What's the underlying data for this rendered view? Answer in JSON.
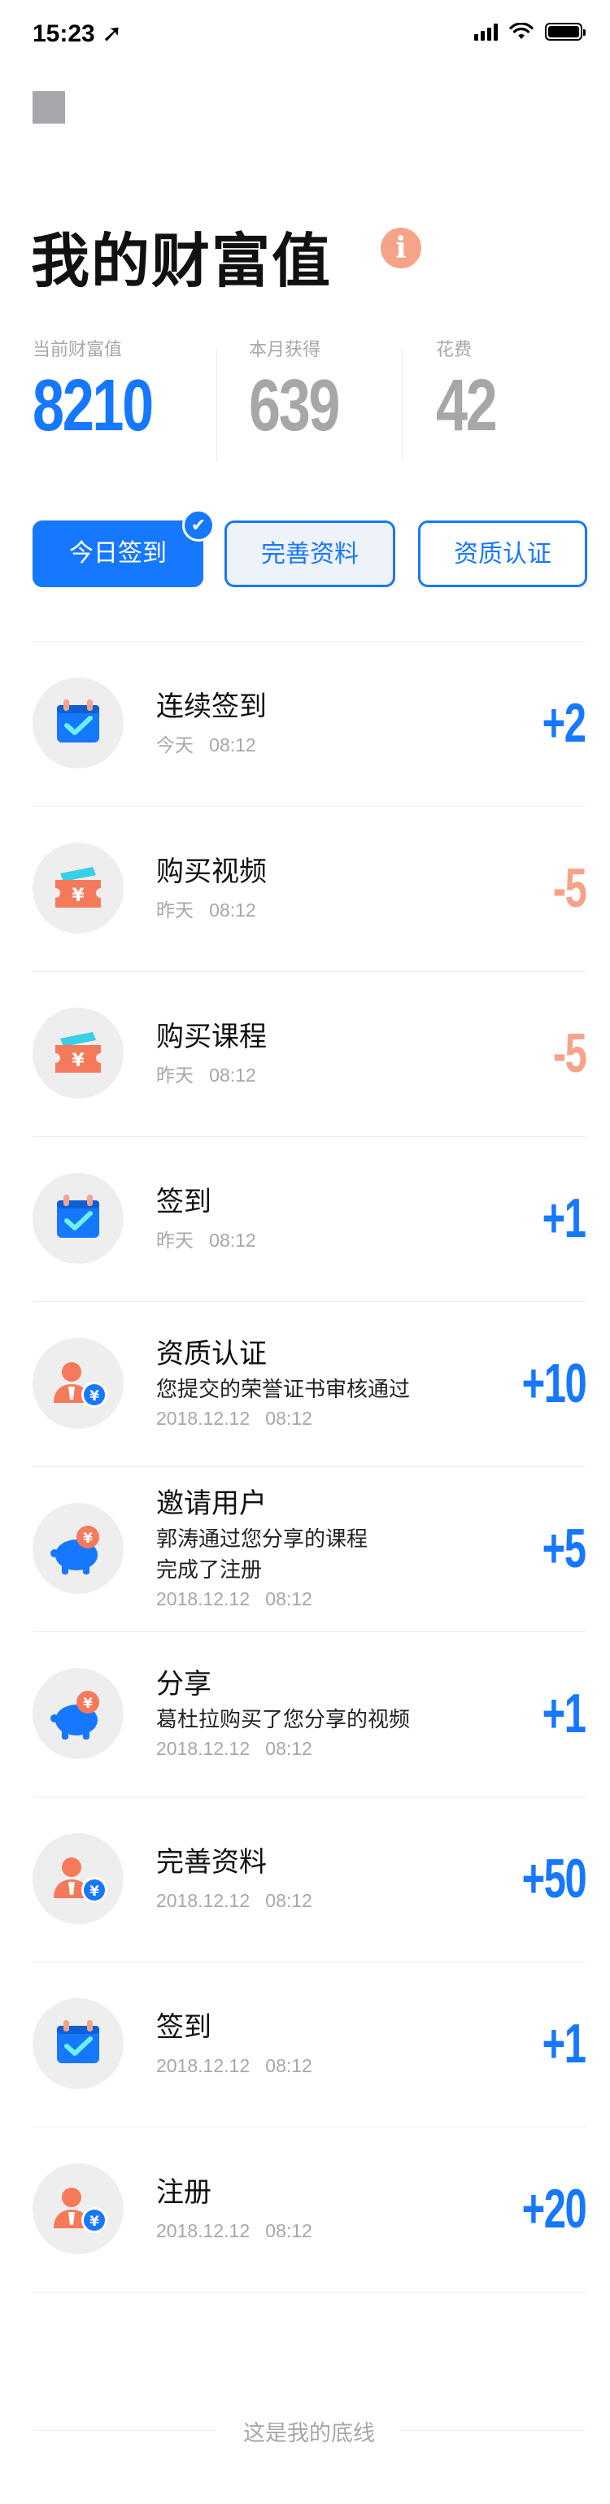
{
  "status_bar": {
    "time": "15:23 ➚"
  },
  "header": {
    "title": "我的财富值",
    "info_glyph": "i"
  },
  "stats": [
    {
      "label": "当前财富值",
      "value": "8210"
    },
    {
      "label": "本月获得",
      "value": "639"
    },
    {
      "label": "花费",
      "value": "42"
    }
  ],
  "actions": {
    "checkin_label": "今日签到",
    "profile_label": "完善资料",
    "certify_label": "资质认证",
    "checked_glyph": "✔"
  },
  "colors": {
    "accent": "#1677ff",
    "negative": "#f5a389",
    "muted": "#a7a7ab"
  },
  "records": [
    {
      "title": "连续签到",
      "desc": "",
      "time": "今天   08:12",
      "score": "+2",
      "icon": "calendar-check-icon"
    },
    {
      "title": "购买视频",
      "desc": "",
      "time": "昨天   08:12",
      "score": "-5",
      "icon": "ticket-yen-icon"
    },
    {
      "title": "购买课程",
      "desc": "",
      "time": "昨天   08:12",
      "score": "-5",
      "icon": "ticket-yen-icon"
    },
    {
      "title": "签到",
      "desc": "",
      "time": "昨天   08:12",
      "score": "+1",
      "icon": "calendar-check-icon"
    },
    {
      "title": "资质认证",
      "desc": "您提交的荣誉证书审核通过",
      "time": "2018.12.12   08:12",
      "score": "+10",
      "icon": "user-yen-icon"
    },
    {
      "title": "邀请用户",
      "desc": "郭涛通过您分享的课程\n完成了注册",
      "time": "2018.12.12   08:12",
      "score": "+5",
      "icon": "piggy-bank-icon"
    },
    {
      "title": "分享",
      "desc": "葛杜拉购买了您分享的视频",
      "time": "2018.12.12   08:12",
      "score": "+1",
      "icon": "piggy-bank-icon"
    },
    {
      "title": "完善资料",
      "desc": "",
      "time": "2018.12.12   08:12",
      "score": "+50",
      "icon": "user-yen-icon"
    },
    {
      "title": "签到",
      "desc": "",
      "time": "2018.12.12   08:12",
      "score": "+1",
      "icon": "calendar-check-icon"
    },
    {
      "title": "注册",
      "desc": "",
      "time": "2018.12.12   08:12",
      "score": "+20",
      "icon": "user-yen-icon"
    }
  ],
  "footer": {
    "text": "这是我的底线"
  }
}
